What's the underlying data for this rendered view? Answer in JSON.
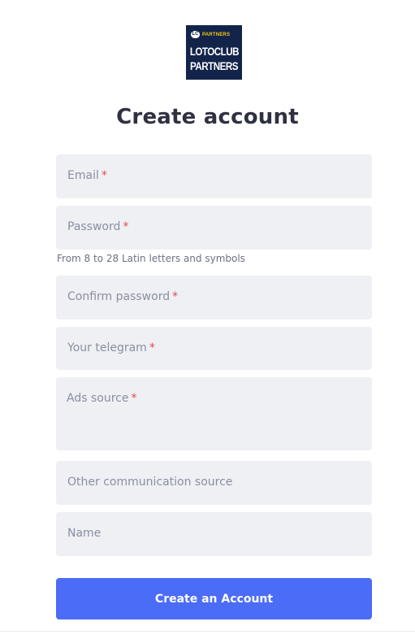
{
  "logo": {
    "badge": "LC",
    "small_text": "PARTNERS",
    "line1": "LOTOCLUB",
    "line2": "PARTNERS"
  },
  "title": "Create account",
  "form": {
    "required_mark": "*",
    "email_label": "Email",
    "password_label": "Password",
    "password_hint": "From 8 to 28 Latin letters and symbols",
    "confirm_password_label": "Confirm password",
    "telegram_label": "Your telegram",
    "ads_source_label": "Ads source",
    "other_source_label": "Other communication source",
    "name_label": "Name",
    "submit_label": "Create an Account"
  },
  "colors": {
    "brand_navy": "#13244a",
    "accent": "#4a6cf7",
    "required": "#e5474f",
    "field_bg": "#eef0f4"
  }
}
